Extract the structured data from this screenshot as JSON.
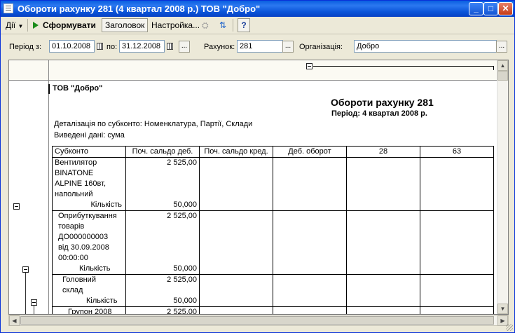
{
  "window": {
    "title": "Обороти рахунку 281 (4 квартал 2008 р.) ТОВ \"Добро\"",
    "controls": [
      "_",
      "□",
      "✕"
    ]
  },
  "toolbar": {
    "actions_label": "Дії",
    "generate_label": "Сформувати",
    "header_label": "Заголовок",
    "settings_label": "Настройка...",
    "help_label": "?"
  },
  "filters": {
    "period_from_label": "Період з:",
    "period_from": "01.10.2008",
    "period_to_label": "по:",
    "period_to": "31.12.2008",
    "account_label": "Рахунок:",
    "account": "281",
    "org_label": "Організація:",
    "org": "Добро",
    "ellipsis": "..."
  },
  "report": {
    "company": "ТОВ \"Добро\"",
    "title": "Обороти рахунку 281",
    "period": "Період: 4 квартал 2008 р.",
    "detail": "Деталізація по субконто: Номенклатура, Партії, Склади",
    "shown": "Виведені дані: сума",
    "columns": [
      "Субконто",
      "Поч. сальдо деб.",
      "Поч. сальдо кред.",
      "Деб. оборот",
      "28",
      "63"
    ],
    "rows": [
      {
        "name_lines": [
          "Вентилятор",
          "BINATONE",
          "ALPINE 160вт,",
          "напольний"
        ],
        "amount": "2 525,00",
        "qty_label": "Кількість",
        "qty": "50,000"
      },
      {
        "name_lines": [
          "Оприбуткування",
          "товарів",
          "ДО000000003",
          "від 30.09.2008",
          "00:00:00"
        ],
        "amount": "2 525,00",
        "qty_label": "Кількість",
        "qty": "50,000"
      },
      {
        "name_lines": [
          "Головний",
          "склад"
        ],
        "amount": "2 525,00",
        "qty_label": "Кількість",
        "qty": "50,000"
      },
      {
        "name_lines": [
          "Групон 2008"
        ],
        "amount": "2 525,00"
      }
    ]
  }
}
